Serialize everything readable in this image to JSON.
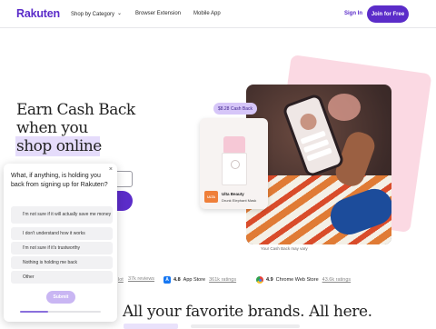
{
  "header": {
    "logo": "Rakuten",
    "nav": [
      "Shop by Category",
      "Browser Extension",
      "Mobile App"
    ],
    "signin": "Sign In",
    "join": "Join for Free"
  },
  "hero": {
    "line1": "Earn Cash Back",
    "line2": "when you",
    "line3": "shop online"
  },
  "product": {
    "cashback": "$8.28 Cash Back",
    "brand_badge": "ULTA",
    "brand_name": "Ulta Beauty",
    "product_name": "Drunk Elephant Mask",
    "caption": "Your Cash Back may vary"
  },
  "ratings": {
    "partial": "37k reviews",
    "partial_prefix": "lot",
    "appstore_score": "4.8",
    "appstore_label": "App Store",
    "appstore_count": "361k ratings",
    "chrome_score": "4.9",
    "chrome_label": "Chrome Web Store",
    "chrome_count": "43.6k ratings"
  },
  "bottom": {
    "heading": "All your favorite brands. All here."
  },
  "survey": {
    "question": "What, if anything, is holding you back from signing up for Rakuten?",
    "options": [
      "I'm not sure if it will actually save me money",
      "I don't understand how it works",
      "I'm not sure if it's trustworthy",
      "Nothing is holding me back",
      "Other"
    ],
    "submit": "Submit",
    "close": "×",
    "progress": 0.35
  }
}
